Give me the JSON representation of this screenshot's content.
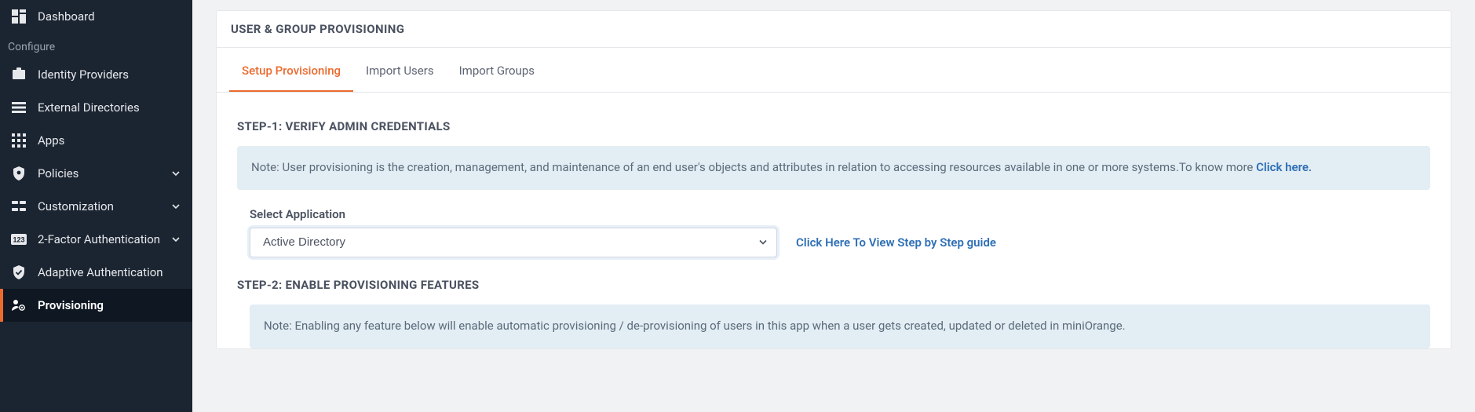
{
  "sidebar": {
    "dashboard": "Dashboard",
    "configure_label": "Configure",
    "items": [
      {
        "label": "Identity Providers"
      },
      {
        "label": "External Directories"
      },
      {
        "label": "Apps"
      },
      {
        "label": "Policies"
      },
      {
        "label": "Customization"
      },
      {
        "label": "2-Factor Authentication"
      },
      {
        "label": "Adaptive Authentication"
      },
      {
        "label": "Provisioning"
      }
    ]
  },
  "header": {
    "title": "USER & GROUP PROVISIONING"
  },
  "tabs": {
    "setup": "Setup Provisioning",
    "import_users": "Import Users",
    "import_groups": "Import Groups"
  },
  "step1": {
    "title": "STEP-1: VERIFY ADMIN CREDENTIALS",
    "note_prefix": "Note: User provisioning is the creation, management, and maintenance of an end user's objects and attributes in relation to accessing resources available in one or more systems.To know more ",
    "note_link": "Click here."
  },
  "select_app": {
    "label": "Select Application",
    "value": "Active Directory"
  },
  "guide_link": "Click Here To View Step by Step guide",
  "step2": {
    "title": "STEP-2: ENABLE PROVISIONING FEATURES",
    "note": "Note: Enabling any feature below will enable automatic provisioning / de-provisioning of users in this app when a user gets created, updated or deleted in miniOrange."
  }
}
